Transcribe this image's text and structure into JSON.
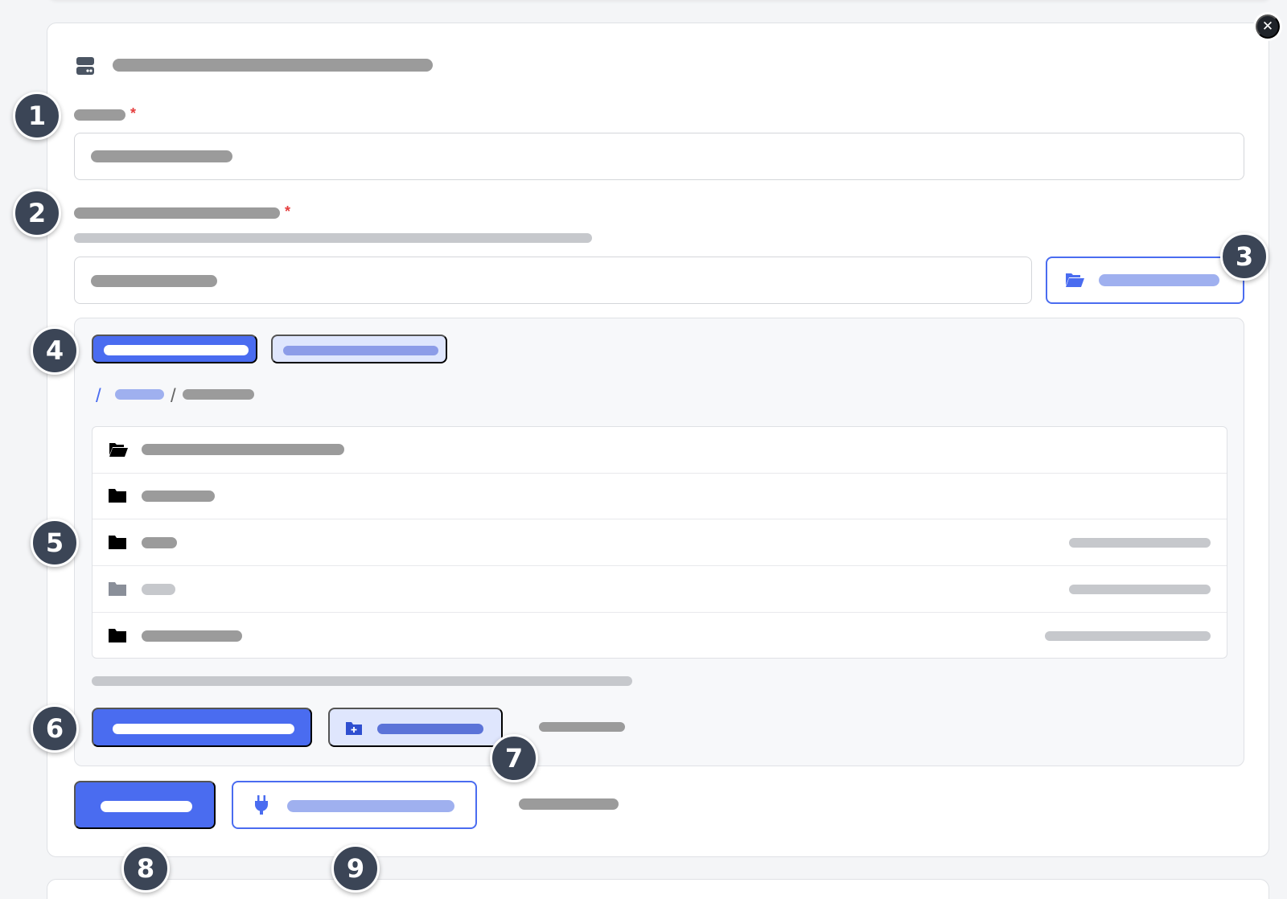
{
  "window": {
    "close_symbol": "✕"
  },
  "form": {
    "header_icon": "server-icon",
    "field1": {
      "required_mark": "*"
    },
    "field2": {
      "required_mark": "*"
    },
    "browse_button_icon": "folder-open-icon",
    "breadcrumb": {
      "root_separator": "/",
      "separator": "/"
    },
    "folder_list": [
      {
        "icon": "folder-open-icon",
        "state": "current"
      },
      {
        "icon": "folder-icon",
        "state": "normal"
      },
      {
        "icon": "folder-icon",
        "state": "normal"
      },
      {
        "icon": "folder-icon",
        "state": "disabled"
      },
      {
        "icon": "folder-icon",
        "state": "normal"
      }
    ],
    "new_folder_icon": "folder-plus-icon",
    "test_button_icon": "plug-icon"
  },
  "annotations": [
    "1",
    "2",
    "3",
    "4",
    "5",
    "6",
    "7",
    "8",
    "9"
  ],
  "colors": {
    "accent": "#4a6cf0",
    "accent_soft": "#dfe6fd",
    "required": "#e53e3e",
    "marker": "#3b4556",
    "placeholder_text": "#9b9b9b"
  }
}
